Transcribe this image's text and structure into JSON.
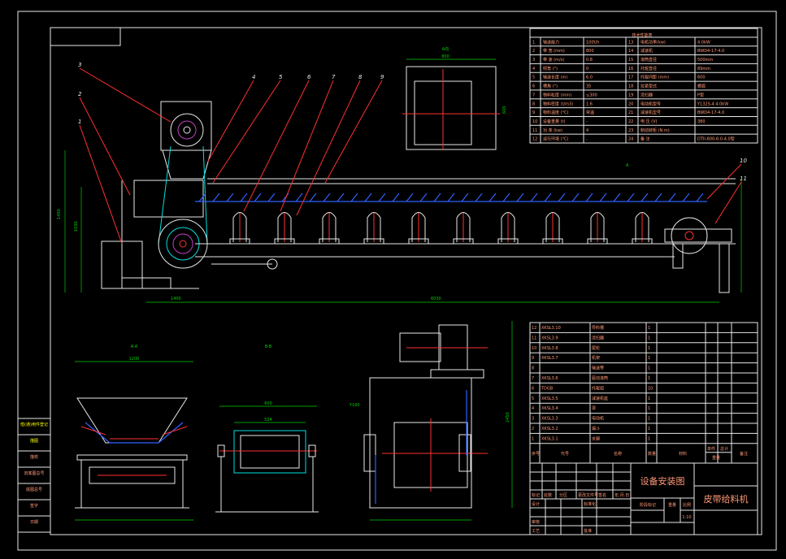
{
  "drawing": {
    "title": "皮带给料机",
    "sheet_title": "设备安装图",
    "scale": "1:10",
    "views": {
      "section_a": "A-A",
      "section_b": "B-B",
      "view_a": "A向",
      "arrow_label": "A"
    },
    "balloons": [
      "1",
      "2",
      "3",
      "4",
      "5",
      "6",
      "7",
      "8",
      "9",
      "10",
      "11"
    ],
    "dimensions": {
      "overall_length": "6030",
      "left_ext": "1400",
      "height_total": "1450",
      "frame_h": "1030",
      "view_a_w": "800",
      "view_a_h": "600",
      "bb_w1": "600",
      "bb_w2": "524",
      "aa_w": "1200",
      "side_h": "2450",
      "motor_pos": "Y160"
    }
  },
  "tech_table": {
    "title": "技术性能表",
    "rows": [
      [
        "1",
        "输送能力",
        "100t/h",
        "13",
        "电机功率(kw)",
        "4.0kW"
      ],
      [
        "2",
        "带 宽 (mm)",
        "800",
        "14",
        "减速机",
        "BWD4-17-4.0"
      ],
      [
        "3",
        "带 速 (m/s)",
        "0.8",
        "15",
        "滚筒直径",
        "500mm"
      ],
      [
        "4",
        "倾角 (°)",
        "0",
        "16",
        "托辊直径",
        "89mm"
      ],
      [
        "5",
        "输送长度 (m)",
        "6.0",
        "17",
        "托辊间距 (mm)",
        "600"
      ],
      [
        "6",
        "槽角 (°)",
        "35",
        "18",
        "拉紧型式",
        "螺旋"
      ],
      [
        "7",
        "物料粒度 (mm)",
        "≤300",
        "19",
        "清扫器",
        "P型"
      ],
      [
        "8",
        "物料密度 (t/m3)",
        "1.6",
        "20",
        "电动机型号",
        "Y132S-4 4.0kW"
      ],
      [
        "9",
        "物料温度 (°C)",
        "常温",
        "21",
        "减速机型号",
        "BWD4-17-4.0"
      ],
      [
        "10",
        "设备重量 (t)",
        "-",
        "22",
        "电 压 (V)",
        "380"
      ],
      [
        "11",
        "功 率 (kw)",
        "4",
        "23",
        "制动转矩 (N·m)",
        ""
      ],
      [
        "12",
        "运行环境 (°C)",
        "-",
        "24",
        "备 注",
        "DTII-800-6.0-4.0型"
      ]
    ]
  },
  "parts_list": {
    "rows": [
      [
        "12",
        "XKSL3.10",
        "导料槽",
        "1"
      ],
      [
        "11",
        "XKSL3.9",
        "清扫器",
        "1"
      ],
      [
        "10",
        "XKSL3.8",
        "尾轮",
        "1"
      ],
      [
        "9",
        "XKSL3.7",
        "机架",
        "1"
      ],
      [
        "8",
        "",
        "输送带",
        "1"
      ],
      [
        "7",
        "XKSL3.6",
        "驱动滚筒",
        "1"
      ],
      [
        "6",
        "TDGB",
        "托辊组",
        "10"
      ],
      [
        "5",
        "XKSL3.5",
        "减速机座",
        "1"
      ],
      [
        "4",
        "XKSL3.4",
        "罩",
        "1"
      ],
      [
        "3",
        "XKSL3.3",
        "电动机",
        "1"
      ],
      [
        "2",
        "XKSL3.2",
        "漏斗",
        "1"
      ],
      [
        "1",
        "XKSL3.1",
        "支腿",
        "1"
      ]
    ],
    "headers": {
      "no": "序号",
      "code": "代号",
      "name": "名称",
      "qty": "数量",
      "material": "材料",
      "unit": "单件",
      "total": "总计",
      "weight": "重量",
      "note": "备注"
    }
  },
  "title_block": {
    "mark": "标记",
    "count": "处数",
    "zone": "分区",
    "change_doc": "更改文件号",
    "sign": "签名",
    "date": "年.月.日",
    "design": "设计",
    "standard": "标准化",
    "review": "审核",
    "process": "工艺",
    "approve": "批准",
    "stage": "阶段标记",
    "weight": "重量",
    "ratio": "比例"
  },
  "left_strip": [
    "借(通)用件登记",
    "描图",
    "描校",
    "旧底图总号",
    "底图总号",
    "签字",
    "日期"
  ]
}
